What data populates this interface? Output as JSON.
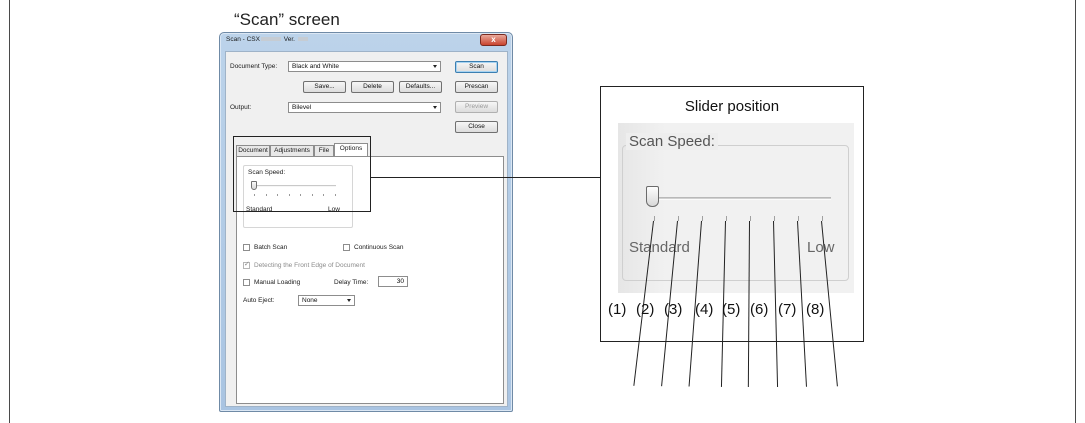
{
  "figure": {
    "screen_caption": "“Scan” screen"
  },
  "dialog": {
    "title_prefix": "Scan - CSX",
    "title_version": "Ver.",
    "close_glyph": "x",
    "document_type_label": "Document Type:",
    "document_type_value": "Black and White",
    "save_button": "Save...",
    "delete_button": "Delete",
    "defaults_button": "Defaults...",
    "output_label": "Output:",
    "output_value": "Bilevel",
    "scan_button": "Scan",
    "prescan_button": "Prescan",
    "preview_button": "Preview",
    "close_button": "Close",
    "tabs": [
      "Document",
      "Adjustments",
      "File",
      "Options"
    ],
    "active_tab": "Options",
    "scan_speed_label": "Scan Speed:",
    "scan_speed_level": 0,
    "speed_min_label": "Standard",
    "speed_max_label": "Low",
    "batch_scan_label": "Batch Scan",
    "continuous_scan_label": "Continuous Scan",
    "detect_front_edge_label": "Detecting the Front Edge of Document",
    "manual_loading_label": "Manual Loading",
    "delay_time_label": "Delay Time:",
    "delay_time_value": "30",
    "auto_eject_label": "Auto Eject:",
    "auto_eject_value": "None"
  },
  "callout": {
    "title": "Slider position",
    "group_label": "Scan Speed:",
    "min_label": "Standard",
    "max_label": "Low",
    "positions": [
      "(1)",
      "(2)",
      "(3)",
      "(4)",
      "(5)",
      "(6)",
      "(7)",
      "(8)"
    ]
  },
  "colors": {
    "window_frame": "#a9c4e2",
    "close_button": "#c9442f",
    "panel": "#f0f0f0"
  }
}
